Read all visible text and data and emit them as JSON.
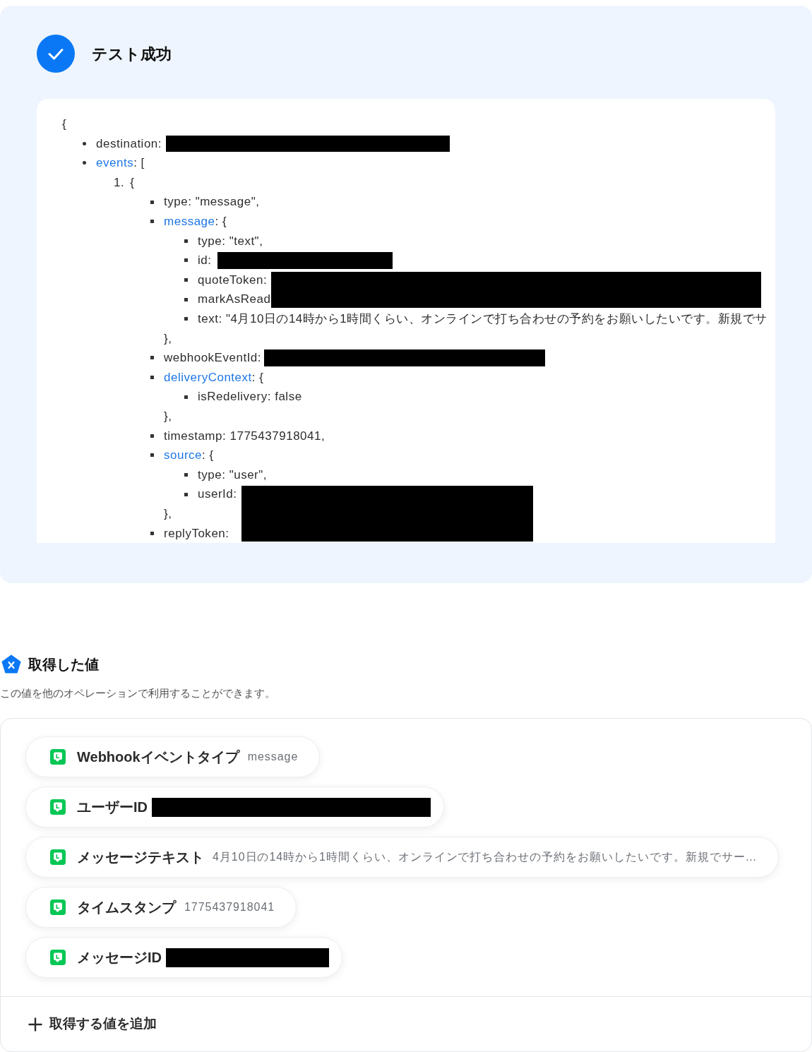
{
  "result": {
    "success": true,
    "title": "テスト成功"
  },
  "payload": {
    "open": "{",
    "items": [
      {
        "kind": "leaf",
        "text": "destination:",
        "redacted": true
      },
      {
        "kind": "branch",
        "key": "events",
        "after": ": [",
        "children": [
          {
            "kind": "entry",
            "index": "1.",
            "after": "{",
            "children": [
              {
                "kind": "leaf",
                "text": "type: \"message\","
              },
              {
                "kind": "branch",
                "key": "message",
                "after": ": {",
                "close": "},",
                "children": [
                  {
                    "kind": "leaf",
                    "text": "type: \"text\","
                  },
                  {
                    "kind": "leaf",
                    "text": "id:",
                    "redacted": true
                  },
                  {
                    "kind": "leaf",
                    "text": "quoteToken:",
                    "redacted": true
                  },
                  {
                    "kind": "leaf",
                    "text": "markAsRead"
                  },
                  {
                    "kind": "leaf",
                    "text": "text: \"4月10日の14時から1時間くらい、オンラインで打ち合わせの予約をお願いしたいです。新規でサ"
                  }
                ]
              },
              {
                "kind": "leaf",
                "text": "webhookEventId:",
                "redacted": true
              },
              {
                "kind": "branch",
                "key": "deliveryContext",
                "after": ": {",
                "close": "},",
                "children": [
                  {
                    "kind": "leaf",
                    "text": "isRedelivery: false"
                  }
                ]
              },
              {
                "kind": "leaf",
                "text": "timestamp: 1775437918041,"
              },
              {
                "kind": "branch",
                "key": "source",
                "after": ": {",
                "close": "},",
                "children": [
                  {
                    "kind": "leaf",
                    "text": "type: \"user\","
                  },
                  {
                    "kind": "leaf",
                    "text": "userId:",
                    "redacted": true
                  }
                ]
              },
              {
                "kind": "leaf",
                "text": "replyToken:"
              }
            ]
          }
        ]
      }
    ]
  },
  "extracted": {
    "title": "取得した値",
    "description": "この値を他のオペレーションで利用することができます。",
    "chips": [
      {
        "label": "Webhookイベントタイプ",
        "value": "message"
      },
      {
        "label": "ユーザーID",
        "redacted": true
      },
      {
        "label": "メッセージテキスト",
        "value": "4月10日の14時から1時間くらい、オンラインで打ち合わせの予約をお願いしたいです。新規でサー…"
      },
      {
        "label": "タイムスタンプ",
        "value": "1775437918041"
      },
      {
        "label": "メッセージID",
        "redacted": true
      }
    ],
    "add_button": "取得する値を追加"
  }
}
